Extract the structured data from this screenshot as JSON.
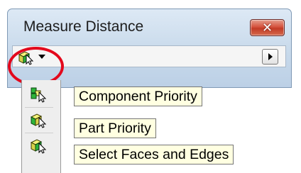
{
  "window": {
    "title": "Measure Distance",
    "close_glyph": "✕"
  },
  "toolbar": {
    "selection_tool_icon": "select-faces-edges-icon",
    "dropdown_icon": "caret-down-icon",
    "expand_icon": "arrow-right-icon"
  },
  "flyout": {
    "items": [
      {
        "label": "Component Priority",
        "icon": "component-priority-icon"
      },
      {
        "label": "Part Priority",
        "icon": "part-priority-icon"
      },
      {
        "label": "Select Faces and Edges",
        "icon": "select-faces-edges-icon"
      }
    ]
  },
  "colors": {
    "highlight": "#e3081c",
    "tooltip_bg": "#ffffe1",
    "close_button": "#c84a33"
  }
}
